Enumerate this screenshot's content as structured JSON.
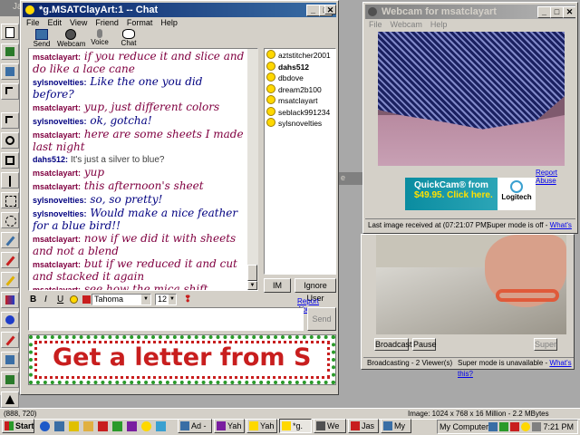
{
  "bg_titles": {
    "top_left": "Jas",
    "behind_webcam": "e"
  },
  "chat_window": {
    "title": "*g.MSATClayArt:1 -- Chat",
    "menu": [
      "File",
      "Edit",
      "View",
      "Friend",
      "Format",
      "Help"
    ],
    "toolbar": [
      "Send File",
      "Webcam",
      "Voice",
      "Chat"
    ],
    "messages": [
      {
        "user": "msatclayart:",
        "text": "if you reduce it and slice and do like a lace cane",
        "style": "a"
      },
      {
        "user": "sylsnovelties:",
        "text": "Like the one you did before?",
        "style": "b"
      },
      {
        "user": "msatclayart:",
        "text": "yup, just different colors",
        "style": "a"
      },
      {
        "user": "sylsnovelties:",
        "text": "ok, gotcha!",
        "style": "b"
      },
      {
        "user": "msatclayart:",
        "text": "here are some sheets I made last night",
        "style": "a"
      },
      {
        "user": "dahs512:",
        "text": "It's just a silver to blue?",
        "style": "c"
      },
      {
        "user": "msatclayart:",
        "text": "yup",
        "style": "a"
      },
      {
        "user": "msatclayart:",
        "text": "this afternoon's sheet",
        "style": "a"
      },
      {
        "user": "sylsnovelties:",
        "text": "so, so pretty!",
        "style": "b"
      },
      {
        "user": "sylsnovelties:",
        "text": "Would make a nice feather for a blue bird!!",
        "style": "b"
      },
      {
        "user": "msatclayart:",
        "text": "now if we did it with sheets and not a blend",
        "style": "a"
      },
      {
        "user": "msatclayart:",
        "text": "but if we reduced it and cut and stacked it again",
        "style": "a"
      },
      {
        "user": "msatclayart:",
        "text": "see how the mica shift makes zig zag designs?",
        "style": "a"
      }
    ],
    "users": [
      "aztstitcher2001",
      "dahs512",
      "dbdove",
      "dream2b100",
      "msatclayart",
      "seblack991234",
      "sylsnovelties"
    ],
    "im_label": "IM",
    "ignore_label": "Ignore User",
    "report_abuse": "Report Abuse",
    "format": {
      "font": "Tahoma",
      "size": "12",
      "bold": "B",
      "italic": "I",
      "underline": "U"
    },
    "send_label": "Send",
    "banner_text": "Get a letter from S"
  },
  "webcam_window": {
    "title": "Webcam for msatclayart",
    "menu": [
      "File",
      "Webcam",
      "Help"
    ],
    "report_abuse": "Report Abuse",
    "ad": {
      "line1": "QuickCam® from",
      "line2": "$49.95. Click here.",
      "brand": "Logitech"
    },
    "last_image": "Last image received at (07:21:07 PM)",
    "super_mode": "Super mode is off - ",
    "whats_this": "What's this?"
  },
  "broadcast": {
    "broadcast_label": "Broadcast",
    "pause_label": "Pause",
    "super_label": "Super",
    "status": "Broadcasting - 2 Viewer(s)",
    "super_mode": "Super mode is unavailable - ",
    "whats_this": "What's this?"
  },
  "editor": {
    "coords": "(888, 720)",
    "image_info": "Image: 1024 x 768 x 16 Million - 2.2 MBytes"
  },
  "taskbar": {
    "start": "Start",
    "tasks": [
      "Ad -",
      "Yah",
      "Yah",
      "*g.",
      "We",
      "Jas",
      "My"
    ],
    "my_computer": "My Computer",
    "time": "7:21 PM"
  }
}
